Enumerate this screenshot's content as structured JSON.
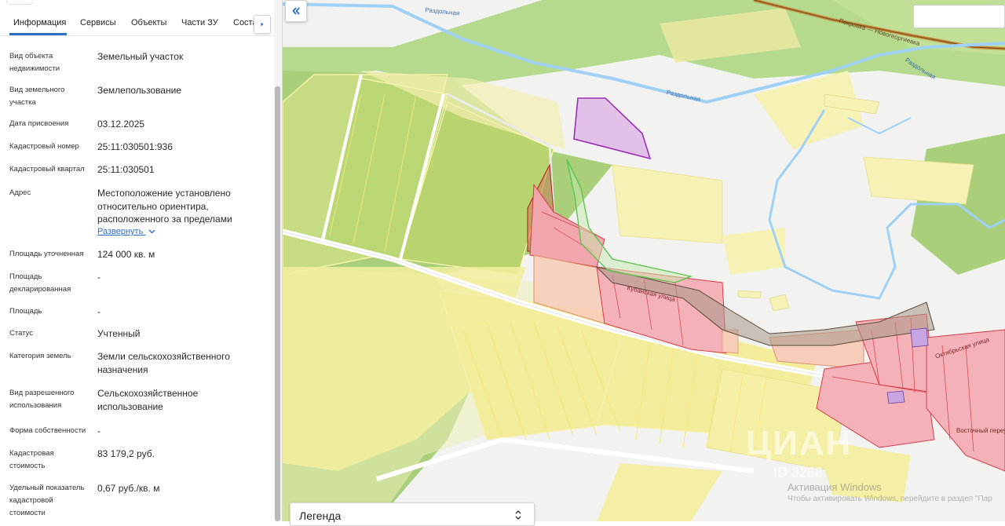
{
  "tabs": {
    "items": [
      {
        "label": "Информация"
      },
      {
        "label": "Сервисы"
      },
      {
        "label": "Объекты"
      },
      {
        "label": "Части ЗУ"
      },
      {
        "label": "Соста"
      }
    ],
    "active_index": 0
  },
  "info": {
    "rows": [
      {
        "label": "Вид объекта недвижимости",
        "value": "Земельный участок"
      },
      {
        "label": "Вид земельного участка",
        "value": "Землепользование"
      },
      {
        "label": "Дата присвоения",
        "value": "03.12.2025"
      },
      {
        "label": "Кадастровый номер",
        "value": "25:11:030501:936"
      },
      {
        "label": "Кадастровый квартал",
        "value": "25:11:030501"
      },
      {
        "label": "Адрес",
        "value": "Местоположение установлено относительно ориентира, расположенного за пределами",
        "link": "Развернуть"
      },
      {
        "label": "Площадь уточненная",
        "value": "124 000 кв. м"
      },
      {
        "label": "Площадь декларированная",
        "value": "-"
      },
      {
        "label": "Площадь",
        "value": "-"
      },
      {
        "label": "Статус",
        "value": "Учтенный"
      },
      {
        "label": "Категория земель",
        "value": "Земли сельскохозяйственного назначения"
      },
      {
        "label": "Вид разрешенного использования",
        "value": "Сельскохозяйственное использование"
      },
      {
        "label": "Форма собственности",
        "value": "-"
      },
      {
        "label": "Кадастровая стоимость",
        "value": "83 179,2 руб."
      },
      {
        "label": "Удельный показатель кадастровой стоимости",
        "value": "0,67 руб./кв. м"
      }
    ]
  },
  "map": {
    "labels": {
      "river1": "Раздольная",
      "river2": "Раздольная",
      "river3": "Раздольная",
      "road1": "Покровка — Новогеоргиевка",
      "street1": "Кубанская улица",
      "street2": "Октябрьская улица",
      "street3": "Восточный переулок"
    },
    "legend_label": "Легенда",
    "watermark_line1": "Активация Windows",
    "watermark_line2": "Чтобы активировать Windows, перейдите в раздел \"Пар",
    "brand_watermark": "ЦИАН",
    "brand_id": "ID 3258"
  },
  "colors": {
    "accent": "#2d6ec7",
    "selected_parcel": "#9b2fb5",
    "settlement_parcel": "#e8707a",
    "field_parcel": "#f3ec9a",
    "forest": "#a9cf7a",
    "river": "#9fd0f5"
  },
  "icons": {
    "tabs_next": "chevron-right-icon",
    "collapse": "double-chevron-left-icon",
    "expand": "chevron-down-icon",
    "legend_toggle": "up-down-chevron-icon"
  }
}
